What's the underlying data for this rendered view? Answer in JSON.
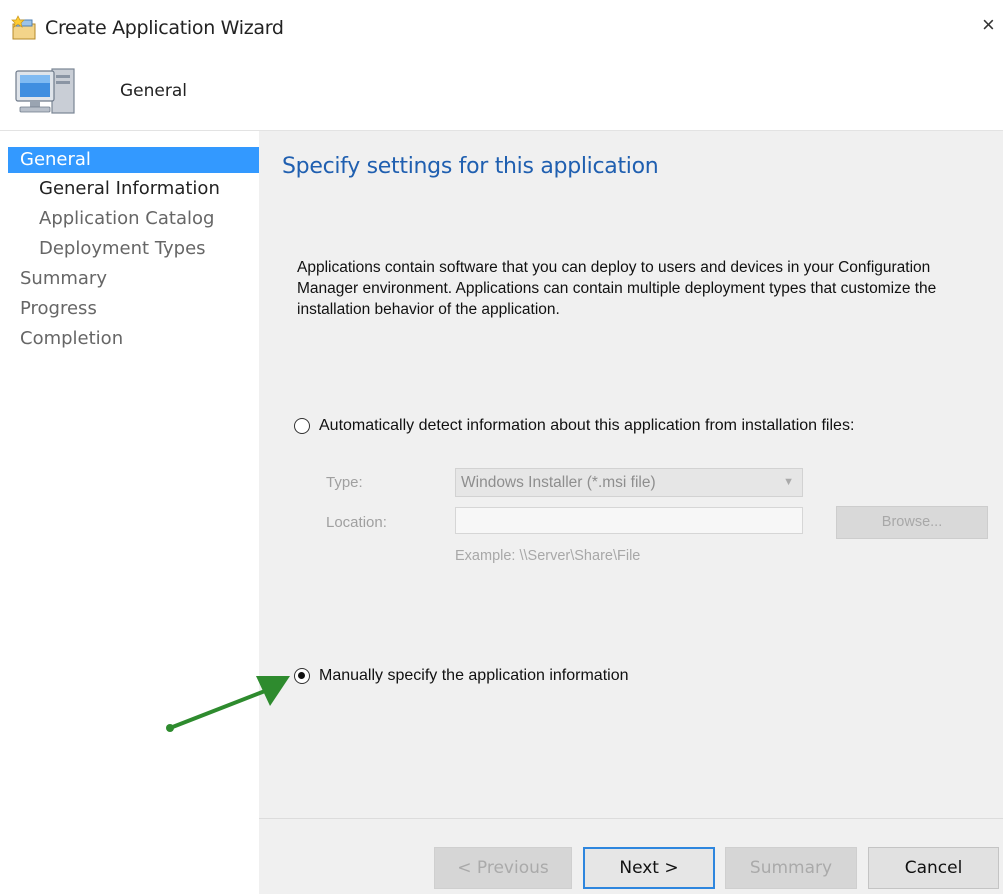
{
  "window": {
    "title": "Create Application Wizard",
    "close_glyph": "×"
  },
  "header": {
    "title": "General"
  },
  "sidebar": {
    "items": [
      {
        "label": "General"
      },
      {
        "label": "General Information"
      },
      {
        "label": "Application Catalog"
      },
      {
        "label": "Deployment Types"
      },
      {
        "label": "Summary"
      },
      {
        "label": "Progress"
      },
      {
        "label": "Completion"
      }
    ]
  },
  "main": {
    "heading": "Specify settings for this application",
    "description": "Applications contain software that you can deploy to users and devices in your Configuration Manager environment. Applications can contain multiple deployment types that customize the installation behavior of the application.",
    "auto_option": {
      "label": "Automatically detect information about this application from installation files:",
      "checked": false,
      "type_label": "Type:",
      "type_value": "Windows Installer (*.msi file)",
      "location_label": "Location:",
      "location_value": "",
      "browse_label": "Browse...",
      "example": "Example: \\\\Server\\Share\\File"
    },
    "manual_option": {
      "label": "Manually specify the application information",
      "checked": true
    }
  },
  "footer": {
    "previous_label": "< Previous",
    "next_label": "Next >",
    "summary_label": "Summary",
    "cancel_label": "Cancel"
  },
  "colors": {
    "accent": "#3399ff",
    "heading": "#1f5fb0",
    "annotation_arrow": "#2e8b2e"
  },
  "icons": {
    "title": "wizard-icon",
    "header": "computer-icon",
    "annotation": "arrow-annotation-icon"
  }
}
